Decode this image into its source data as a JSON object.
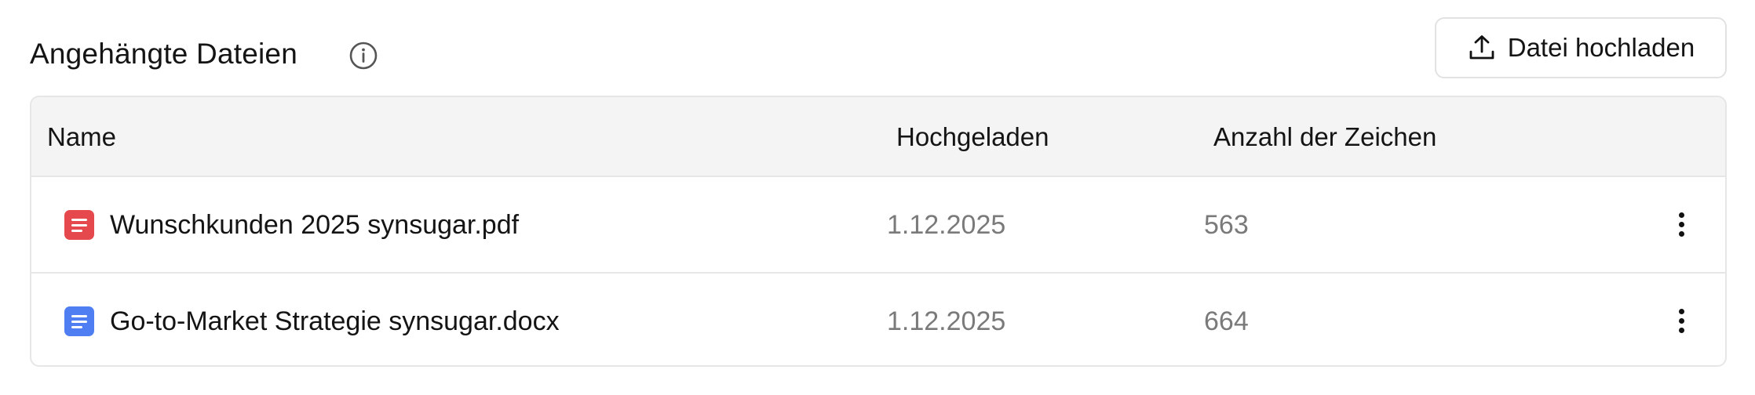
{
  "section": {
    "title": "Angehängte Dateien",
    "info_icon": "info-circle-icon"
  },
  "upload_button": {
    "label": "Datei hochladen",
    "icon": "upload-icon"
  },
  "table": {
    "columns": [
      "Name",
      "Hochgeladen",
      "Anzahl der Zeichen"
    ],
    "rows": [
      {
        "name": "Wunschkunden 2025 synsugar.pdf",
        "uploaded": "1.12.2025",
        "chars": "563",
        "icon": "pdf-file-icon",
        "icon_color": "#e5484d"
      },
      {
        "name": "Go-to-Market Strategie synsugar.docx",
        "uploaded": "1.12.2025",
        "chars": "664",
        "icon": "docx-file-icon",
        "icon_color": "#4f7ef2"
      }
    ],
    "row_menu_icon": "more-vertical-icon"
  }
}
